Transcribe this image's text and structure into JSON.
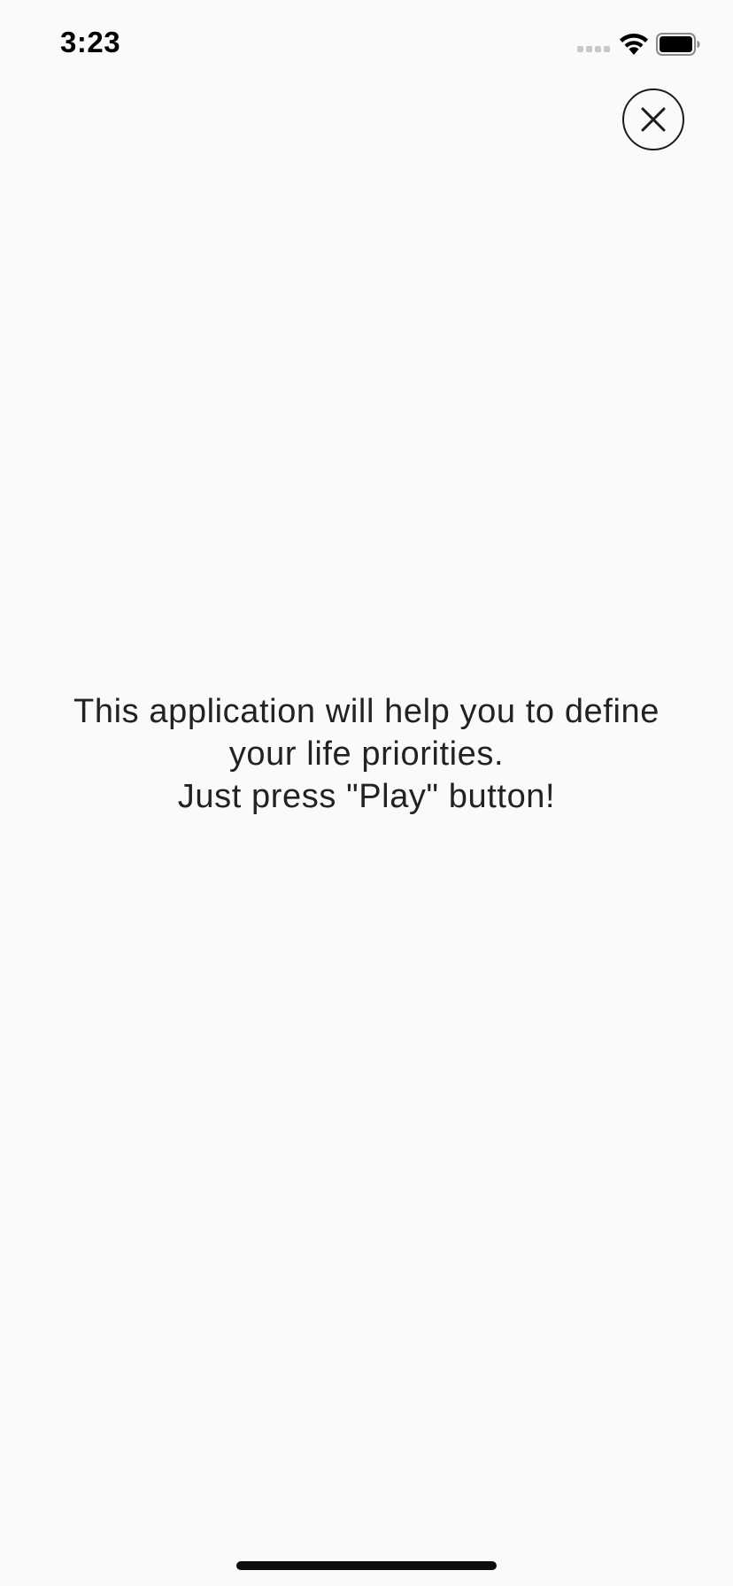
{
  "status_bar": {
    "time": "3:23",
    "signal_icon": "cellular-signal-icon",
    "wifi_icon": "wifi-icon",
    "battery_icon": "battery-icon"
  },
  "close": {
    "icon": "close-icon"
  },
  "intro": {
    "line1": "This application will help you to define",
    "line2": "your life priorities.",
    "line3": "Just press \"Play\" button!"
  }
}
